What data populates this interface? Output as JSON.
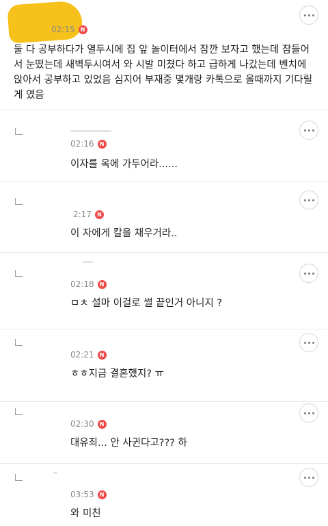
{
  "comments": [
    {
      "time": "02:15",
      "badge": "N",
      "text": "둘 다 공부하다가 열두시에 집 앞 놀이터에서 잠깐 보자고 했는데 잠들어서 눈떴는데 새벽두시여서 와 시발 미쳤다 하고 급하게 나갔는데 벤치에 앉아서 공부하고 있었음 심지어 부재중 몇개랑 카톡으로 올때까지 기다릴게 였음"
    },
    {
      "time": "02:16",
      "badge": "N",
      "text": "이자를 옥에 가두어라......"
    },
    {
      "time": "2:17",
      "badge": "N",
      "text": "이 자에게 칼을 채우거라.."
    },
    {
      "time": "02:18",
      "badge": "N",
      "text": "ㅁㅊ 설마 이걸로 썰 끝인거 아니지 ?"
    },
    {
      "time": "02:21",
      "badge": "N",
      "text": "ㅎㅎ지금 결혼했지? ㅠ"
    },
    {
      "time": "02:30",
      "badge": "N",
      "text": "대유죄... 안 사귄다고??? 하"
    },
    {
      "time": "03:53",
      "badge": "N",
      "text": "와 미친"
    }
  ],
  "icons": {
    "more": "more-options-icon",
    "reply": "reply-arrow-icon",
    "new": "new-badge-icon"
  },
  "colors": {
    "badge": "#f04a4a",
    "redaction": "#f6c11b"
  }
}
